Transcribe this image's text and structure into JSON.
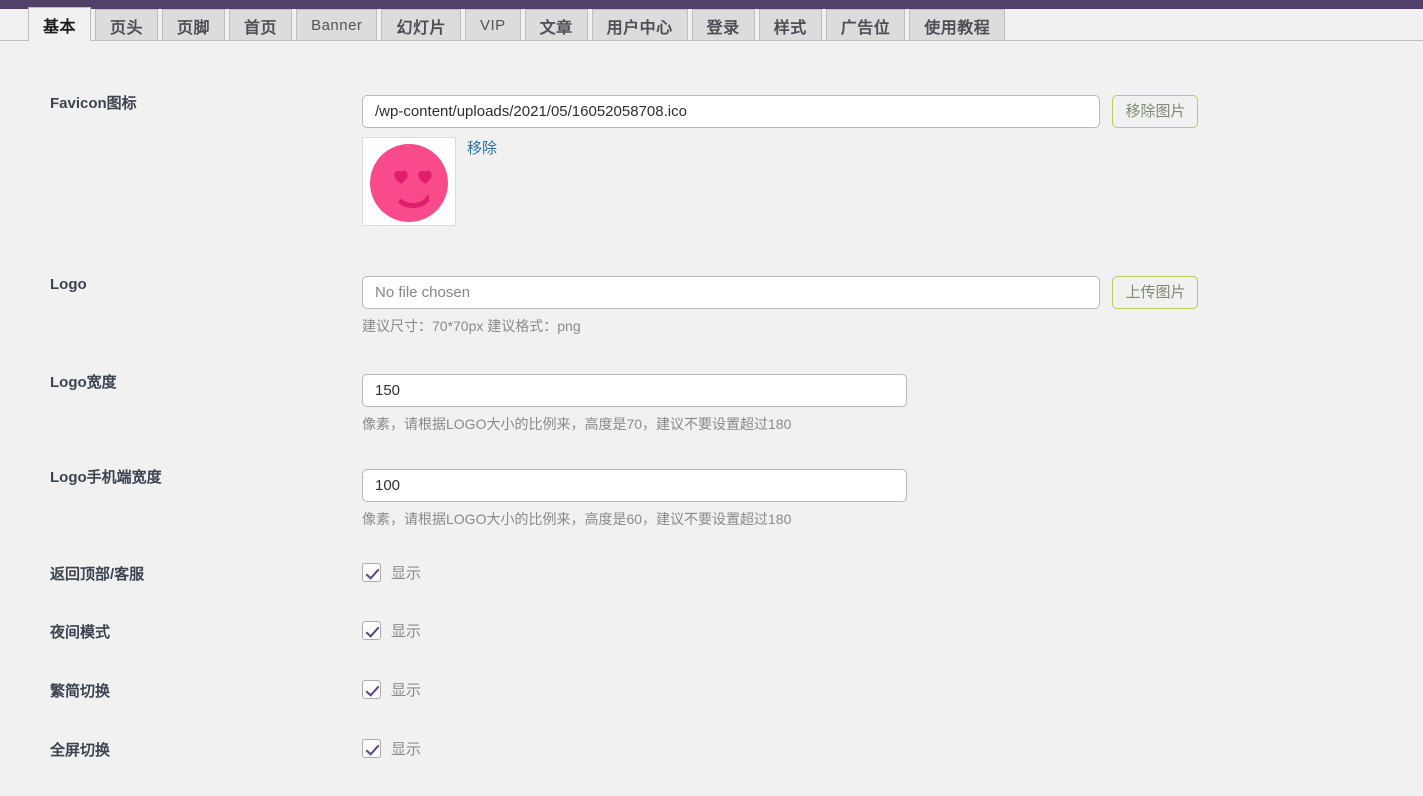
{
  "theme": {
    "admin_bar_color": "#50406a",
    "page_bg": "#f1f1f1",
    "accent_button_border": "#b9cc5f",
    "link_color": "#2a6fa8",
    "checkbox_check_color": "#5b4380"
  },
  "tabs": [
    {
      "label": "基本",
      "active": true,
      "latin": false
    },
    {
      "label": "页头",
      "active": false,
      "latin": false
    },
    {
      "label": "页脚",
      "active": false,
      "latin": false
    },
    {
      "label": "首页",
      "active": false,
      "latin": false
    },
    {
      "label": "Banner",
      "active": false,
      "latin": true
    },
    {
      "label": "幻灯片",
      "active": false,
      "latin": false
    },
    {
      "label": "VIP",
      "active": false,
      "latin": true
    },
    {
      "label": "文章",
      "active": false,
      "latin": false
    },
    {
      "label": "用户中心",
      "active": false,
      "latin": false
    },
    {
      "label": "登录",
      "active": false,
      "latin": false
    },
    {
      "label": "样式",
      "active": false,
      "latin": false
    },
    {
      "label": "广告位",
      "active": false,
      "latin": false
    },
    {
      "label": "使用教程",
      "active": false,
      "latin": false
    }
  ],
  "form": {
    "favicon": {
      "label": "Favicon图标",
      "value": "/wp-content/uploads/2021/05/16052058708.ico",
      "placeholder": "",
      "button_label": "移除图片",
      "remove_link_label": "移除",
      "preview_icon": "pink-heart-eyes-smiley-favicon"
    },
    "logo": {
      "label": "Logo",
      "value": "",
      "placeholder": "No file chosen",
      "button_label": "上传图片",
      "hint": "建议尺寸：70*70px 建议格式：png"
    },
    "logo_width": {
      "label": "Logo宽度",
      "value": "150",
      "placeholder": "",
      "hint": "像素，请根据LOGO大小的比例来，高度是70，建议不要设置超过180"
    },
    "logo_mobile_width": {
      "label": "Logo手机端宽度",
      "value": "100",
      "placeholder": "",
      "hint": "像素，请根据LOGO大小的比例来，高度是60，建议不要设置超过180"
    },
    "back_to_top": {
      "label": "返回顶部/客服",
      "checkbox_label": "显示",
      "checked": true
    },
    "night_mode": {
      "label": "夜间模式",
      "checkbox_label": "显示",
      "checked": true
    },
    "traditional_simplified": {
      "label": "繁简切换",
      "checkbox_label": "显示",
      "checked": true
    },
    "fullscreen_toggle": {
      "label": "全屏切换",
      "checkbox_label": "显示",
      "checked": true
    }
  }
}
